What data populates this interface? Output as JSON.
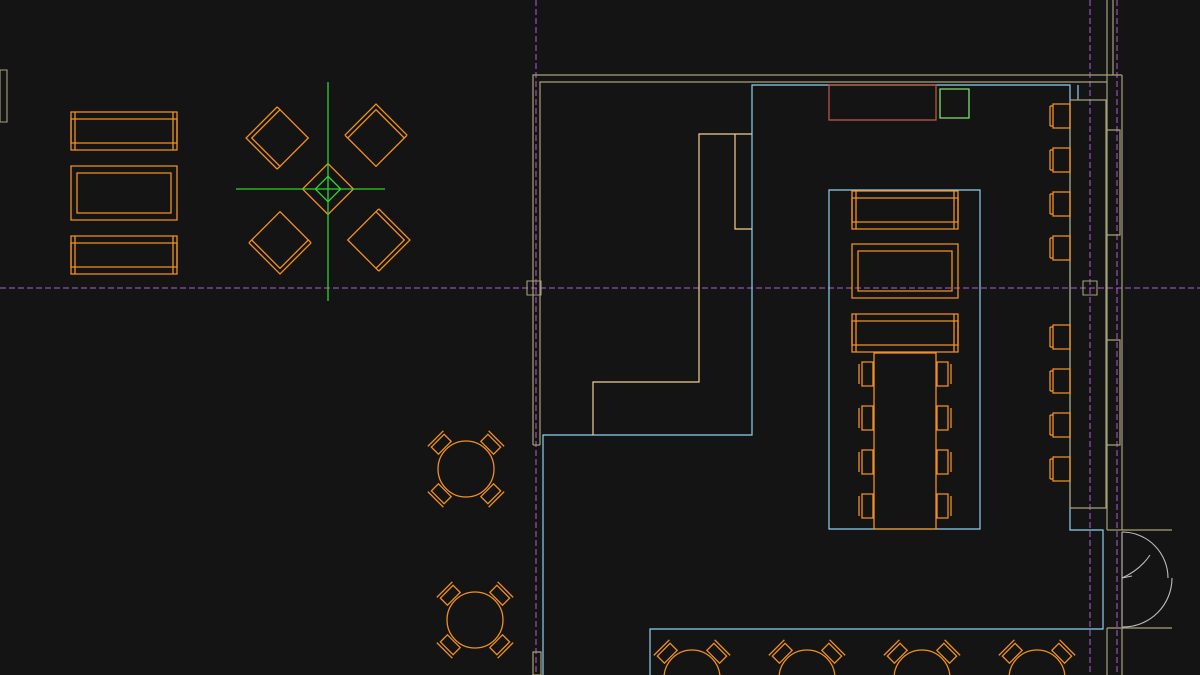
{
  "drawing": {
    "background": "#141414",
    "colors": {
      "furniture": "#f09020",
      "exterior_wall": "#a6a27a",
      "interior_partition": "#8fd0ee",
      "counter_outline": "#f0d090",
      "grid_line": "#b25cd6",
      "door": "#bdbdbd",
      "crosshair": "#2fd12f",
      "reception_desk": "#c05a48",
      "small_fixture": "#7ee06f"
    },
    "crosshair_icon": "crosshair-cursor-icon",
    "door_icon": "double-swing-door-icon"
  }
}
